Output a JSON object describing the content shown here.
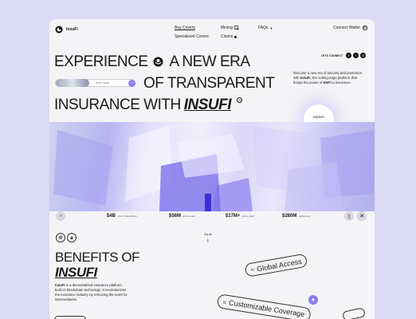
{
  "brand": {
    "name": "InsuFi"
  },
  "nav": {
    "buy_covers": "Buy Covers",
    "specialized_covers": "Specialized Covers",
    "mining": "Mining",
    "claims": "Claims",
    "faqs": "FAQs",
    "connect_wallet": "Connect Wallet"
  },
  "hero": {
    "line1_a": "EXPERIENCE",
    "line1_b": "A NEW ERA",
    "line2": "OF TRANSPARENT",
    "line3_a": "INSURANCE WITH",
    "line3_b": "INSUFI",
    "registered": "R",
    "mini_pill": "learn more",
    "lets_connect": "LETS CONNECT",
    "description_pre": "Discover a new era of security and protection with ",
    "description_brand": "InsuFi",
    "description_mid": ", the cutting-edge platform that brings the power of ",
    "description_defi": "DeFi",
    "description_post": " to insurance.",
    "explore": "explore"
  },
  "stats": [
    {
      "value": "$4B",
      "label": "cover underwritten"
    },
    {
      "value": "$56M",
      "label": "active cover"
    },
    {
      "value": "$17M+",
      "label": "claims paid"
    },
    {
      "value": "$280M",
      "label": "capital pool"
    }
  ],
  "scroll_label": "Scroll",
  "benefits": {
    "title_line1": "BENEFITS OF",
    "title_line2": "INSUFI",
    "body_brand": "InsuFi",
    "body": " is a decentralized insurance platform built on blockchain technology. It revolutionizes the insurance industry by removing the need for intermediaries.",
    "pill1_num": "01",
    "pill1_label": "Global Access",
    "pill2_num": "02",
    "pill2_label": "Customizable Coverage"
  },
  "colors": {
    "background": "#dcd9f3",
    "card": "#f4f3f6",
    "accent": "#7b6cf0",
    "text": "#1a1a1a"
  }
}
